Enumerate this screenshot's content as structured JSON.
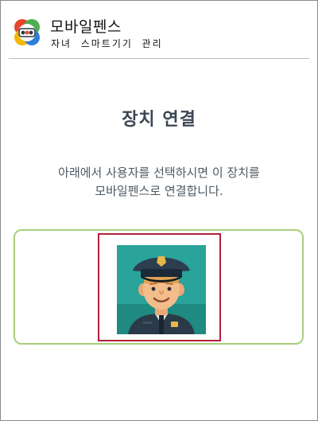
{
  "app": {
    "brand_name": "모바일펜스",
    "tagline": "자녀  스마트기기  관리"
  },
  "main": {
    "title": "장치 연결",
    "instruction_lines": [
      "아래에서 사용자를 선택하시면 이 장치를",
      "모바일펜스로 연결합니다."
    ]
  },
  "colors": {
    "title": "#3b4652",
    "text": "#4d5963",
    "panel_border": "#a7cf7b",
    "selected_border": "#b01f3a",
    "avatar_background": "#2aa39a"
  },
  "icons": {
    "logo": "mobilefence-logo",
    "avatar": "police-officer-avatar"
  }
}
